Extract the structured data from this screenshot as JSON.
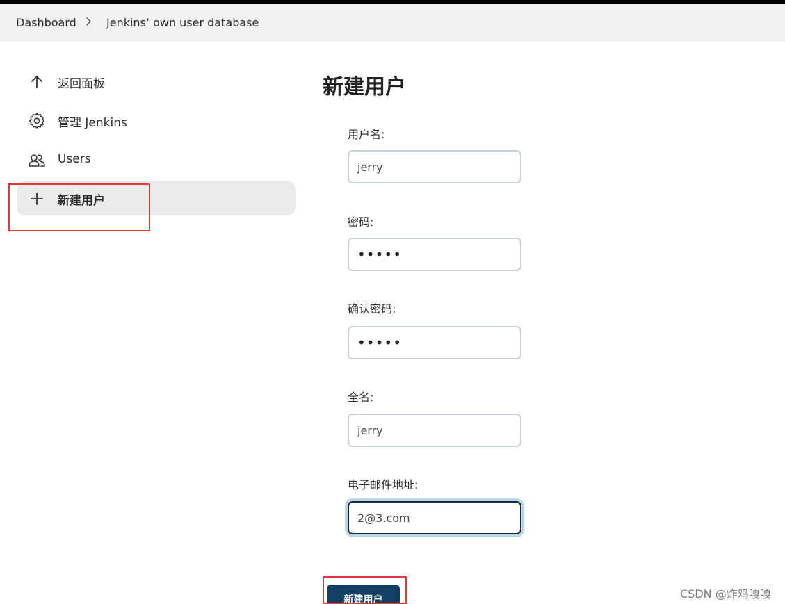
{
  "breadcrumb": {
    "items": [
      "Dashboard",
      "Jenkins’ own user database"
    ]
  },
  "sidebar": {
    "items": [
      {
        "label": "返回面板",
        "icon": "arrow-up-icon"
      },
      {
        "label": "管理 Jenkins",
        "icon": "gear-icon"
      },
      {
        "label": "Users",
        "icon": "users-icon"
      },
      {
        "label": "新建用户",
        "icon": "plus-icon",
        "active": true
      }
    ]
  },
  "page": {
    "title": "新建用户"
  },
  "form": {
    "username": {
      "label": "用户名:",
      "value": "jerry"
    },
    "password": {
      "label": "密码:",
      "value": "•••••"
    },
    "confirm_password": {
      "label": "确认密码:",
      "value": "•••••"
    },
    "fullname": {
      "label": "全名:",
      "value": "jerry"
    },
    "email": {
      "label": "电子邮件地址:",
      "value": "2@3.com"
    },
    "submit_label": "新建用户"
  },
  "watermark": "CSDN @炸鸡嘎嘎",
  "colors": {
    "primary_button": "#123f63",
    "highlight_box": "#e53935",
    "focus_ring": "#b9d8ec"
  }
}
